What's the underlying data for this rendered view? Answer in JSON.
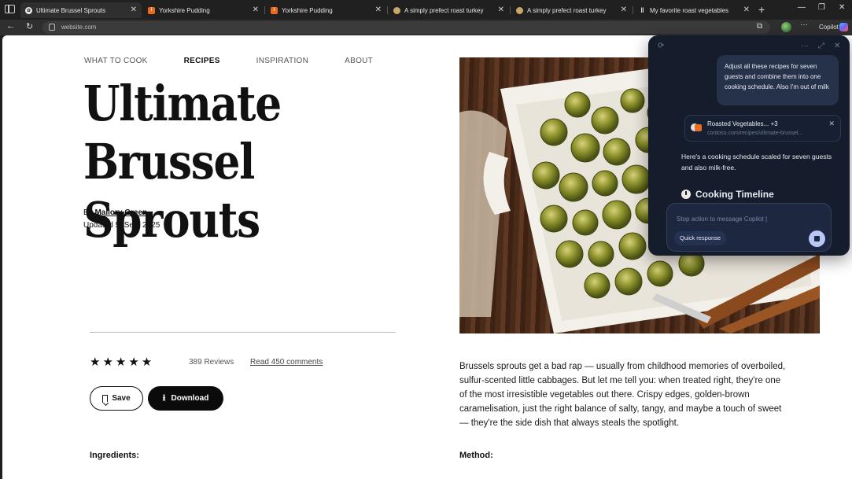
{
  "browser": {
    "tabs": [
      {
        "title": "Ultimate Brussel Sprouts",
        "icon": "sprout-favicon",
        "active": true
      },
      {
        "title": "Yorkshire Pudding",
        "icon": "recipe-favicon"
      },
      {
        "title": "Yorkshire Pudding",
        "icon": "recipe-favicon"
      },
      {
        "title": "A simply prefect roast turkey",
        "icon": "turkey-favicon"
      },
      {
        "title": "A simply prefect roast turkey",
        "icon": "turkey-favicon"
      },
      {
        "title": "My favorite roast vegetables",
        "icon": "utensils-favicon"
      }
    ],
    "url": "website.com",
    "copilot_label": "Copilot"
  },
  "page": {
    "nav": [
      "WHAT TO COOK",
      "RECIPES",
      "INSPIRATION",
      "ABOUT"
    ],
    "title_line1": "Ultimate",
    "title_line2": "Brussel Sprouts",
    "by": "By",
    "author": "Mallory Green",
    "updated": "Updated 5. Sep, 2025",
    "rating": 5,
    "reviews": "389 Reviews",
    "comments_link": "Read 450 comments",
    "save_label": "Save",
    "download_label": "Download",
    "intro": "Brussels sprouts get a bad rap — usually from childhood memories of overboiled, sulfur-scented little cabbages. But let me tell you: when treated right, they're one of the most irresistible vegetables out there. Crispy edges, golden-brown caramelisation, just the right balance of salty, tangy, and maybe a touch of sweet — they're the side dish that always steals the spotlight.",
    "ingredients_heading": "Ingredients:",
    "method_heading": "Method:"
  },
  "copilot": {
    "user_message": "Adjust all these recipes for seven guests and combine them into one cooking schedule. Also I'm out of milk",
    "attachment_title": "Roasted Vegetables... +3",
    "attachment_url": "contoso.com/recipes/ultimate-brussel...",
    "reply": "Here's a cooking schedule scaled for seven guests and also milk-free.",
    "timeline_heading": "Cooking Timeline",
    "composer_placeholder": "Stop action to message Copilot |",
    "quick_response": "Quick response"
  }
}
